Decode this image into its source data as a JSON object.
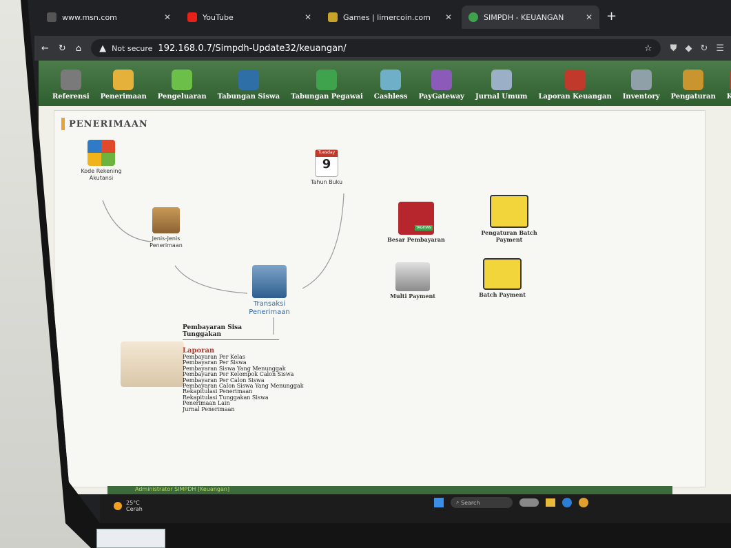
{
  "browser": {
    "tabs": [
      {
        "title": "www.msn.com"
      },
      {
        "title": "YouTube"
      },
      {
        "title": "Games | limercoin.com"
      },
      {
        "title": "SIMPDH - KEUANGAN"
      }
    ],
    "security": "Not secure",
    "url": "192.168.0.7/Simpdh-Update32/keuangan/"
  },
  "menu": [
    {
      "label": "Referensi",
      "color": "#7a7a7a"
    },
    {
      "label": "Penerimaan",
      "color": "#e5b13a"
    },
    {
      "label": "Pengeluaran",
      "color": "#6cc04a"
    },
    {
      "label": "Tabungan Siswa",
      "color": "#2f6fa8"
    },
    {
      "label": "Tabungan Pegawai",
      "color": "#3fa34d"
    },
    {
      "label": "Cashless",
      "color": "#6fb0c8"
    },
    {
      "label": "PayGateway",
      "color": "#8a5bb8"
    },
    {
      "label": "Jurnal Umum",
      "color": "#9bb0c6"
    },
    {
      "label": "Laporan Keuangan",
      "color": "#c0392b"
    },
    {
      "label": "Inventory",
      "color": "#8fa0a8"
    },
    {
      "label": "Pengaturan",
      "color": "#c8952f"
    },
    {
      "label": "Keluar",
      "color": "#d7302a"
    }
  ],
  "page": {
    "title": "PENERIMAAN",
    "nodes": {
      "kode_rekening": "Kode Rekening Akutansi",
      "tahun_buku": "Tahun Buku",
      "calendar_day": "Tuesday",
      "calendar_num": "9",
      "jenis": "Jenis-Jenis Penerimaan",
      "transaksi": "Transaksi Penerimaan",
      "besar": "Besar Pembayaran",
      "tagihan": "TAGIHAN",
      "pengaturan_batch": "Pengaturan Batch Payment",
      "multi": "Multi Payment",
      "batch": "Batch Payment"
    },
    "links_header": "Pembayaran Sisa Tunggakan",
    "laporan_title": "Laporan",
    "laporan": [
      "Pembayaran Per Kelas",
      "Pembayaran Per Siswa",
      "Pembayaran Siswa Yang Menunggak",
      "Pembayaran Per Kelompok Calon Siswa",
      "Pembayaran Per Calon Siswa",
      "Pembayaran Calon Siswa Yang Menunggak",
      "Rekapitulasi Penerimaan",
      "Rekapitulasi Tunggakan Siswa",
      "Penerimaan Lain",
      "Jurnal Penerimaan"
    ],
    "status": "Administrator SIMPDH [Keuangan]"
  },
  "taskbar": {
    "temp": "25°C",
    "cond": "Cerah",
    "search": "Search"
  }
}
